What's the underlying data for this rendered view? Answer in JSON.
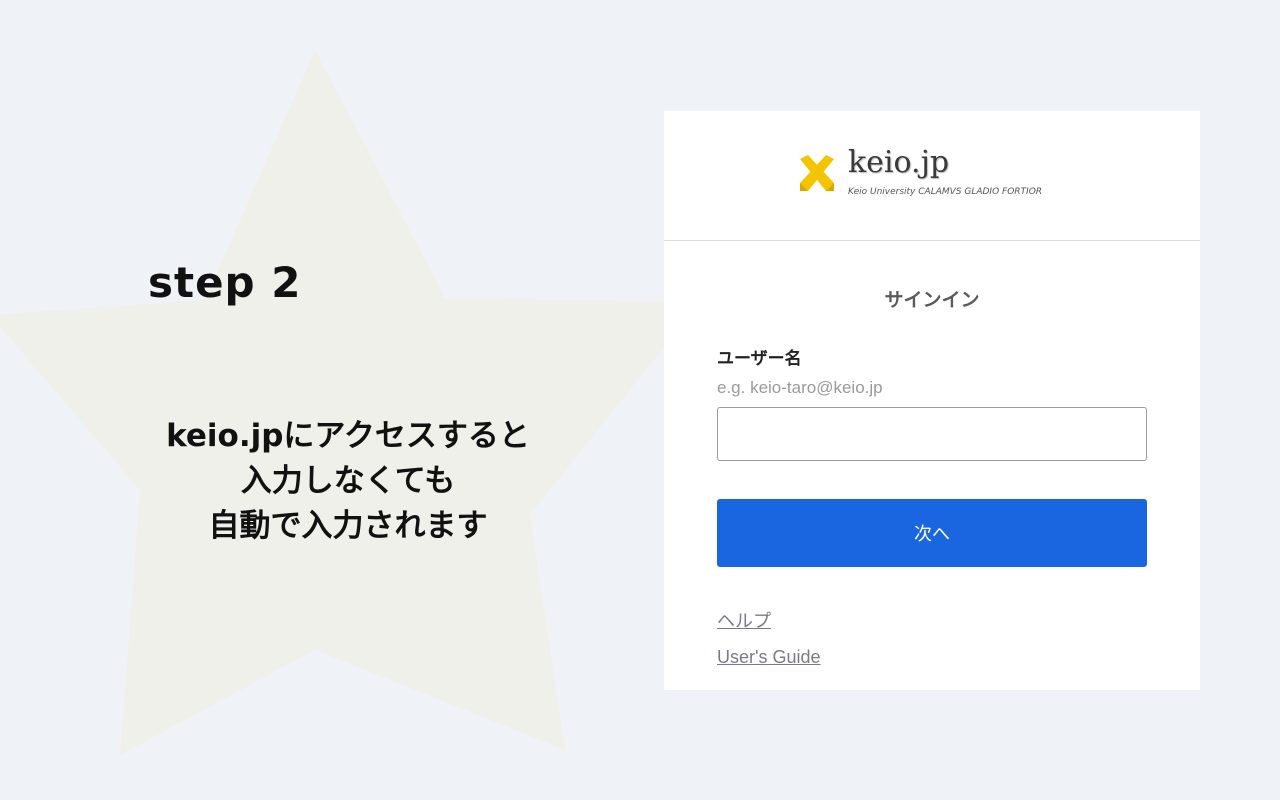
{
  "step": {
    "title": "step 2",
    "caption": [
      "keio.jpにアクセスすると",
      "入力しなくても",
      "自動で入力されます"
    ]
  },
  "logo": {
    "name": "keio.jp",
    "tagline": "Keio University CALAMVS GLADIO FORTIOR",
    "icon": "crossed-pens-icon"
  },
  "signin": {
    "title": "サインイン",
    "username_label": "ユーザー名",
    "username_hint": "e.g. keio-taro@keio.jp",
    "username_value": "",
    "next_label": "次へ",
    "help_link": "ヘルプ",
    "guide_link": "User's Guide"
  },
  "colors": {
    "background": "#eff2f6",
    "star": "#f0f0ea",
    "accent": "#1966e0",
    "logo_mark": "#f5c400"
  }
}
